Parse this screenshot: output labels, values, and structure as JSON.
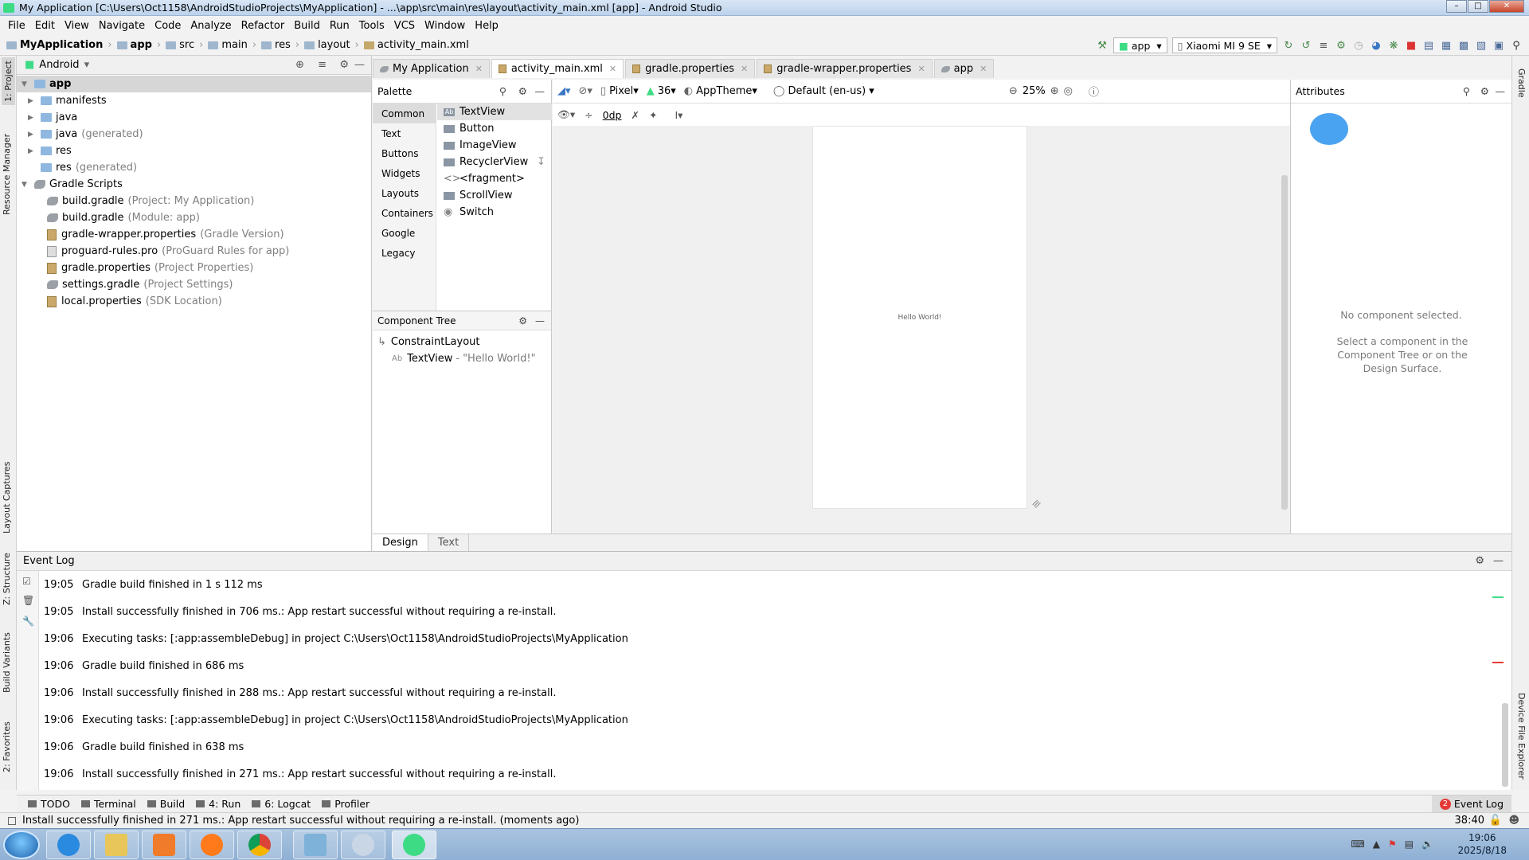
{
  "window": {
    "title": "My Application [C:\\Users\\Oct1158\\AndroidStudioProjects\\MyApplication] - ...\\app\\src\\main\\res\\layout\\activity_main.xml [app] - Android Studio"
  },
  "menu": [
    "File",
    "Edit",
    "View",
    "Navigate",
    "Code",
    "Analyze",
    "Refactor",
    "Build",
    "Run",
    "Tools",
    "VCS",
    "Window",
    "Help"
  ],
  "breadcrumb": [
    "MyApplication",
    "app",
    "src",
    "main",
    "res",
    "layout",
    "activity_main.xml"
  ],
  "run_config": "app",
  "device": "Xiaomi MI 9 SE",
  "left_tool_tabs": [
    "1: Project",
    "Resource Manager",
    "Layout Captures",
    "Z: Structure",
    "Build Variants",
    "2: Favorites"
  ],
  "right_tool_tabs": [
    "Gradle",
    "Device File Explorer"
  ],
  "project": {
    "view": "Android",
    "tree": [
      {
        "label": "app",
        "note": ""
      },
      {
        "label": "manifests",
        "note": ""
      },
      {
        "label": "java",
        "note": ""
      },
      {
        "label": "java",
        "note": "(generated)"
      },
      {
        "label": "res",
        "note": ""
      },
      {
        "label": "res",
        "note": "(generated)"
      },
      {
        "label": "Gradle Scripts",
        "note": ""
      },
      {
        "label": "build.gradle",
        "note": "(Project: My Application)"
      },
      {
        "label": "build.gradle",
        "note": "(Module: app)"
      },
      {
        "label": "gradle-wrapper.properties",
        "note": "(Gradle Version)"
      },
      {
        "label": "proguard-rules.pro",
        "note": "(ProGuard Rules for app)"
      },
      {
        "label": "gradle.properties",
        "note": "(Project Properties)"
      },
      {
        "label": "settings.gradle",
        "note": "(Project Settings)"
      },
      {
        "label": "local.properties",
        "note": "(SDK Location)"
      }
    ]
  },
  "editor_tabs": [
    "My Application",
    "activity_main.xml",
    "gradle.properties",
    "gradle-wrapper.properties",
    "app"
  ],
  "palette": {
    "title": "Palette",
    "categories": [
      "Common",
      "Text",
      "Buttons",
      "Widgets",
      "Layouts",
      "Containers",
      "Google",
      "Legacy"
    ],
    "items": [
      "TextView",
      "Button",
      "ImageView",
      "RecyclerView",
      "<fragment>",
      "ScrollView",
      "Switch"
    ]
  },
  "component_tree": {
    "title": "Component Tree",
    "root": "ConstraintLayout",
    "child": "TextView",
    "child_text": "\"Hello World!\""
  },
  "design_toolbar": {
    "device": "Pixel",
    "api": "36",
    "theme": "AppTheme",
    "locale": "Default (en-us)",
    "zoom": "25%",
    "margin": "0dp"
  },
  "canvas": {
    "text": "Hello World!"
  },
  "attributes": {
    "title": "Attributes",
    "empty": "No component selected.",
    "hint": "Select a component in the Component Tree or on the Design Surface."
  },
  "design_tabs": [
    "Design",
    "Text"
  ],
  "event_log": {
    "title": "Event Log",
    "entries": [
      {
        "time": "19:05",
        "msg": "Gradle build finished in 1 s 112 ms"
      },
      {
        "time": "19:05",
        "msg": "Install successfully finished in 706 ms.: App restart successful without requiring a re-install."
      },
      {
        "time": "19:06",
        "msg": "Executing tasks: [:app:assembleDebug] in project C:\\Users\\Oct1158\\AndroidStudioProjects\\MyApplication"
      },
      {
        "time": "19:06",
        "msg": "Gradle build finished in 686 ms"
      },
      {
        "time": "19:06",
        "msg": "Install successfully finished in 288 ms.: App restart successful without requiring a re-install."
      },
      {
        "time": "19:06",
        "msg": "Executing tasks: [:app:assembleDebug] in project C:\\Users\\Oct1158\\AndroidStudioProjects\\MyApplication"
      },
      {
        "time": "19:06",
        "msg": "Gradle build finished in 638 ms"
      },
      {
        "time": "19:06",
        "msg": "Install successfully finished in 271 ms.: App restart successful without requiring a re-install."
      }
    ]
  },
  "bottom_tools": [
    "TODO",
    "Terminal",
    "Build",
    "4: Run",
    "6: Logcat",
    "Profiler"
  ],
  "event_log_badge": {
    "count": "2",
    "label": "Event Log"
  },
  "status": {
    "message": "Install successfully finished in 271 ms.: App restart successful without requiring a re-install. (moments ago)",
    "position": "38:40"
  },
  "clock": {
    "time": "19:06",
    "date": "2025/8/18"
  },
  "colors": {
    "accent_green": "#3ddc84",
    "selection": "#d6d6d6",
    "error_red": "#e53935"
  }
}
